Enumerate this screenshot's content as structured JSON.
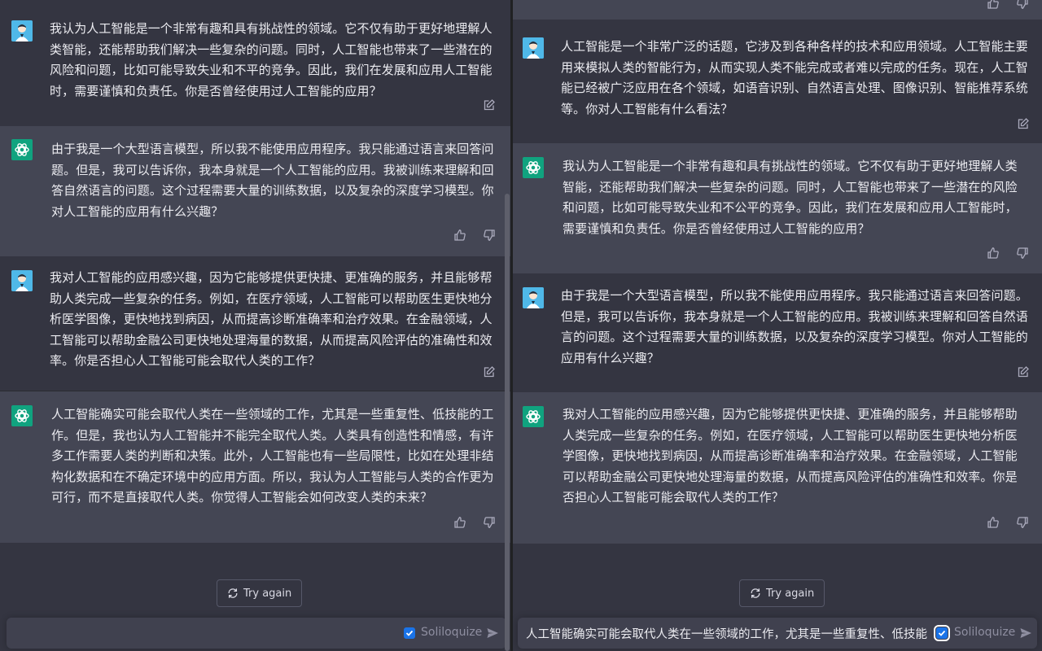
{
  "left": {
    "messages": [
      {
        "role": "user",
        "text": "我认为人工智能是一个非常有趣和具有挑战性的领域。它不仅有助于更好地理解人类智能，还能帮助我们解决一些复杂的问题。同时，人工智能也带来了一些潜在的风险和问题，比如可能导致失业和不平的竞争。因此，我们在发展和应用人工智能时，需要谨慎和负责任。你是否曾经使用过人工智能的应用？"
      },
      {
        "role": "assistant",
        "text": "由于我是一个大型语言模型，所以我不能使用应用程序。我只能通过语言来回答问题。但是，我可以告诉你，我本身就是一个人工智能的应用。我被训练来理解和回答自然语言的问题。这个过程需要大量的训练数据，以及复杂的深度学习模型。你对人工智能的应用有什么兴趣？"
      },
      {
        "role": "user",
        "text": "我对人工智能的应用感兴趣，因为它能够提供更快捷、更准确的服务，并且能够帮助人类完成一些复杂的任务。例如，在医疗领域，人工智能可以帮助医生更快地分析医学图像，更快地找到病因，从而提高诊断准确率和治疗效果。在金融领域，人工智能可以帮助金融公司更快地处理海量的数据，从而提高风险评估的准确性和效率。你是否担心人工智能可能会取代人类的工作？"
      },
      {
        "role": "assistant",
        "text": "人工智能确实可能会取代人类在一些领域的工作，尤其是一些重复性、低技能的工作。但是，我也认为人工智能并不能完全取代人类。人类具有创造性和情感，有许多工作需要人类的判断和决策。此外，人工智能也有一些局限性，比如在处理非结构化数据和在不确定环境中的应用方面。所以，我认为人工智能与人类的合作更为可行，而不是直接取代人类。你觉得人工智能会如何改变人类的未来？"
      }
    ],
    "try_again": "Try again",
    "input_value": "",
    "soliloquize": "Soliloquize"
  },
  "right": {
    "messages": [
      {
        "role": "user",
        "text": "人工智能是一个非常广泛的话题，它涉及到各种各样的技术和应用领域。人工智能主要用来模拟人类的智能行为，从而实现人类不能完成或者难以完成的任务。现在，人工智能已经被广泛应用在各个领域，如语音识别、自然语言处理、图像识别、智能推荐系统等。你对人工智能有什么看法？"
      },
      {
        "role": "assistant",
        "text": "我认为人工智能是一个非常有趣和具有挑战性的领域。它不仅有助于更好地理解人类智能，还能帮助我们解决一些复杂的问题。同时，人工智能也带来了一些潜在的风险和问题，比如可能导致失业和不公平的竞争。因此，我们在发展和应用人工智能时，需要谨慎和负责任。你是否曾经使用过人工智能的应用？"
      },
      {
        "role": "user",
        "text": "由于我是一个大型语言模型，所以我不能使用应用程序。我只能通过语言来回答问题。但是，我可以告诉你，我本身就是一个人工智能的应用。我被训练来理解和回答自然语言的问题。这个过程需要大量的训练数据，以及复杂的深度学习模型。你对人工智能的应用有什么兴趣？"
      },
      {
        "role": "assistant",
        "text": "我对人工智能的应用感兴趣，因为它能够提供更快捷、更准确的服务，并且能够帮助人类完成一些复杂的任务。例如，在医疗领域，人工智能可以帮助医生更快地分析医学图像，更快地找到病因，从而提高诊断准确率和治疗效果。在金融领域，人工智能可以帮助金融公司更快地处理海量的数据，从而提高风险评估的准确性和效率。你是否担心人工智能可能会取代人类的工作？"
      }
    ],
    "try_again": "Try again",
    "input_value": "人工智能确实可能会取代人类在一些领域的工作，尤其是一些重复性、低技能",
    "soliloquize": "Soliloquize"
  },
  "colors": {
    "user_bg": "#343541",
    "bot_bg": "#444654",
    "bot_avatar": "#10a37f",
    "user_avatar": "#1fa2d8",
    "checkbox": "#1a73e8"
  },
  "icons": [
    "user-avatar-icon",
    "openai-logo-icon",
    "edit-icon",
    "thumbs-up-icon",
    "thumbs-down-icon",
    "refresh-icon",
    "send-icon",
    "checkbox-checked-icon"
  ]
}
